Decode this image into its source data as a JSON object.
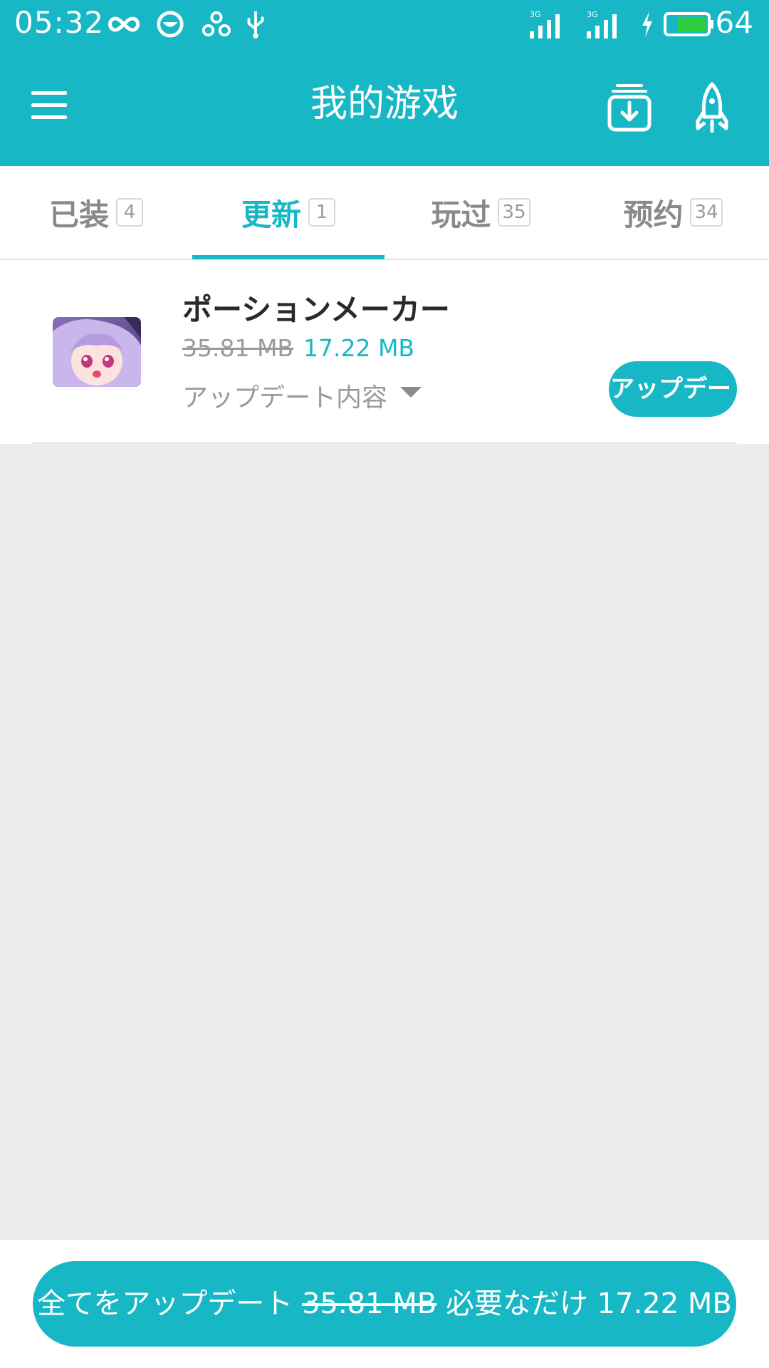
{
  "status_bar": {
    "time": "05:32",
    "battery": "64",
    "icons": [
      "infinity-icon",
      "smile-circle-icon",
      "share-knot-icon",
      "usb-icon",
      "signal-3g-icon",
      "signal-3g-icon",
      "charging-icon",
      "battery-icon"
    ],
    "signal_label": "3G"
  },
  "app_bar": {
    "title": "我的游戏",
    "left_icon": "menu-icon",
    "right_icons": [
      "download-manager-icon",
      "rocket-icon"
    ]
  },
  "tabs": [
    {
      "label": "已装",
      "count": "4",
      "active": false
    },
    {
      "label": "更新",
      "count": "1",
      "active": true
    },
    {
      "label": "玩过",
      "count": "35",
      "active": false
    },
    {
      "label": "预约",
      "count": "34",
      "active": false
    }
  ],
  "update_item": {
    "name": "ポーションメーカー",
    "size_old": "35.81 MB",
    "size_new": "17.22 MB",
    "changelog_label": "アップデート内容",
    "button_label": "アップデー",
    "thumbnail_icon": "game-thumbnail"
  },
  "bottom_bar": {
    "prefix": "全てをアップデート",
    "size_old": "35.81 MB",
    "middle": "必要なだけ",
    "size_new": "17.22 MB"
  },
  "colors": {
    "accent": "#18b7c5",
    "background": "#ececec",
    "battery_fill": "#2ecc40"
  }
}
